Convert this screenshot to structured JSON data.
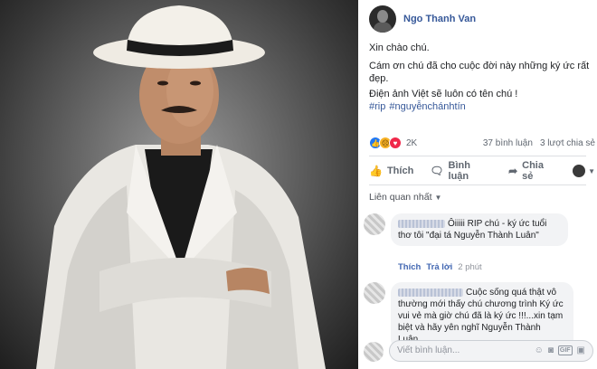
{
  "post": {
    "author": "Ngo Thanh Van",
    "paragraphs": [
      "Xin chào chú.",
      "Cám ơn chú đã cho cuộc đời này những ký ức rất đẹp.",
      "Điện ảnh Việt sẽ luôn có tên chú !"
    ],
    "hashtags": [
      "#rip",
      "#nguyễnchánhtín"
    ]
  },
  "stats": {
    "reaction_count": "2K",
    "comments": "37 bình luận",
    "shares": "3 lượt chia sẻ"
  },
  "actions": {
    "like": "Thích",
    "comment": "Bình luận",
    "share": "Chia sẻ"
  },
  "sort_label": "Liên quan nhất",
  "comments": [
    {
      "text": "Ôiiiii RIP chú - ký ức tuổi thơ tôi \"đại tá Nguyễn Thành Luân\"",
      "like_label": "Thích",
      "reply_label": "Trả lời",
      "time": "2 phút"
    },
    {
      "text": "Cuộc sống quá thật vô thường mới thấy chú chương trình Ký ức vui vẻ mà giờ chú đã là ký ức !!!...xin tạm biệt và hãy yên nghĩ Nguyễn Thành Luân..."
    }
  ],
  "reply": {
    "placeholder": "Viết bình luận..."
  },
  "colors": {
    "link": "#365899",
    "like_reaction": "#2078f4",
    "love_reaction": "#f0284a",
    "sad_reaction": "#f7b125"
  }
}
